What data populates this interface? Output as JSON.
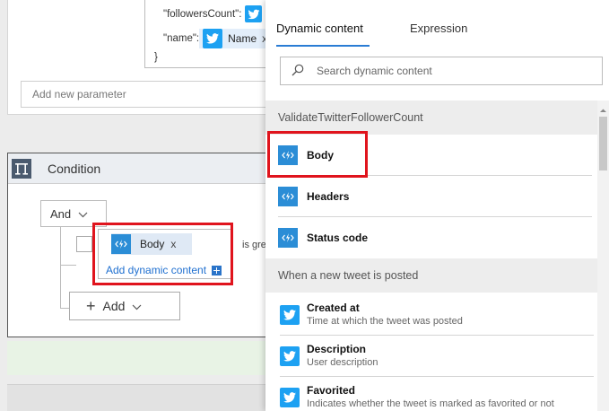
{
  "json_box": {
    "followers_label": "\"followersCount\":",
    "name_label": "\"name\":",
    "name_token": "Name",
    "name_token_remove": "x",
    "closing_brace": "}"
  },
  "add_param": {
    "placeholder": "Add new parameter"
  },
  "condition": {
    "title": "Condition",
    "operator": "And",
    "body_token": "Body",
    "body_token_remove": "x",
    "add_dynamic": "Add dynamic content",
    "comparator": "is gre",
    "add_button": "Add"
  },
  "flyout": {
    "tabs": [
      "Dynamic content",
      "Expression"
    ],
    "search_placeholder": "Search dynamic content",
    "sections": [
      {
        "title": "ValidateTwitterFollowerCount",
        "items": [
          {
            "label": "Body",
            "icon": "bolt-icon"
          },
          {
            "label": "Headers",
            "icon": "bolt-icon"
          },
          {
            "label": "Status code",
            "icon": "bolt-icon"
          }
        ]
      },
      {
        "title": "When a new tweet is posted",
        "items": [
          {
            "label": "Created at",
            "desc": "Time at which the tweet was posted",
            "icon": "twitter-icon"
          },
          {
            "label": "Description",
            "desc": "User description",
            "icon": "twitter-icon"
          },
          {
            "label": "Favorited",
            "desc": "Indicates whether the tweet is marked as favorited or not",
            "icon": "twitter-icon"
          }
        ]
      }
    ]
  },
  "colors": {
    "twitter": "#1da1f2",
    "bolt": "#2b8dd6",
    "highlight": "#e0141d",
    "accent": "#2a7cd4"
  }
}
